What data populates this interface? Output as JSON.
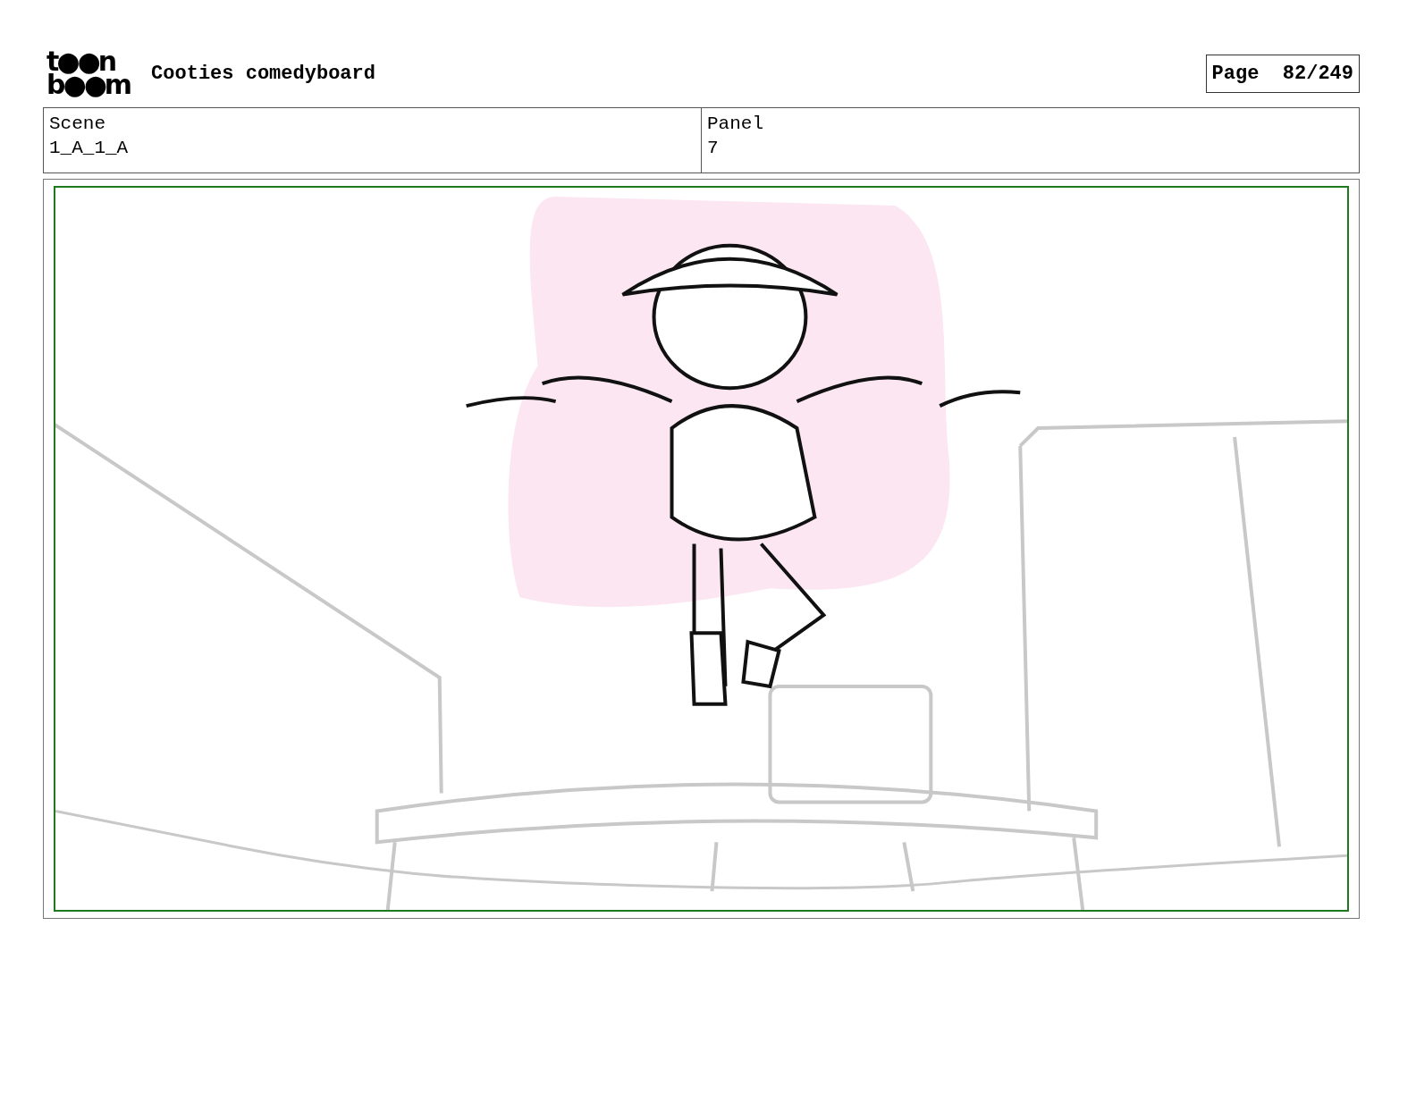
{
  "header": {
    "logo_lines": [
      "t●●n",
      "b●●m"
    ],
    "title": "Cooties comedyboard",
    "page_label": "Page",
    "page_number": "82/249"
  },
  "fields": [
    {
      "label": "Scene",
      "value": "1_A_1_A"
    },
    {
      "label": "Panel",
      "value": "7"
    }
  ]
}
